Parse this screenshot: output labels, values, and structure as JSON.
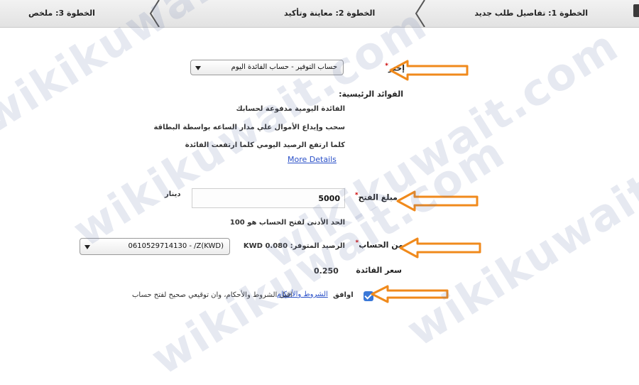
{
  "steps": {
    "step1": "الخطوة 1: تفاصيل طلب جديد",
    "step2": "الخطوة 2: معاينة وتأكيد",
    "step3": "الخطوة 3: ملخص"
  },
  "form": {
    "select_label": "إختر",
    "select_value": "حساب التوفير - حساب الفائدة اليوم",
    "benefits_label": "الفوائد الرئيسية:",
    "benefits": [
      "الفائدة اليومية مدفوعة لحسابك",
      "سحب وإيداع الأموال علي مدار الساعه بواسطة البطاقة",
      "كلما ارتفع الرصيد اليومي كلما ارتفعت الفائدة"
    ],
    "more_details": "More Details",
    "amount_label": "مبلغ الفتح",
    "amount_value": "5000",
    "currency": "دينار",
    "min_note": "الحد الأدنى لفتح الحساب هو 100",
    "from_account_label": "من الحساب",
    "available_balance": "الرصيد المتوفر: KWD 0.080",
    "account_value": "0610529714130 - /Z(KWD)",
    "interest_label": "سعر الفائدة",
    "interest_value": "0.250",
    "agree_prefix": "اوافق",
    "terms_link": "الشروط والأحكام",
    "agree_text": "اقبل الشروط والأحكام، وان توقيعي صحيح لفتح حساب"
  },
  "watermark": "wikikuwait.com",
  "colors": {
    "arrow": "#f08a1c",
    "link": "#2a50c8",
    "checkbox": "#3a78d8"
  }
}
